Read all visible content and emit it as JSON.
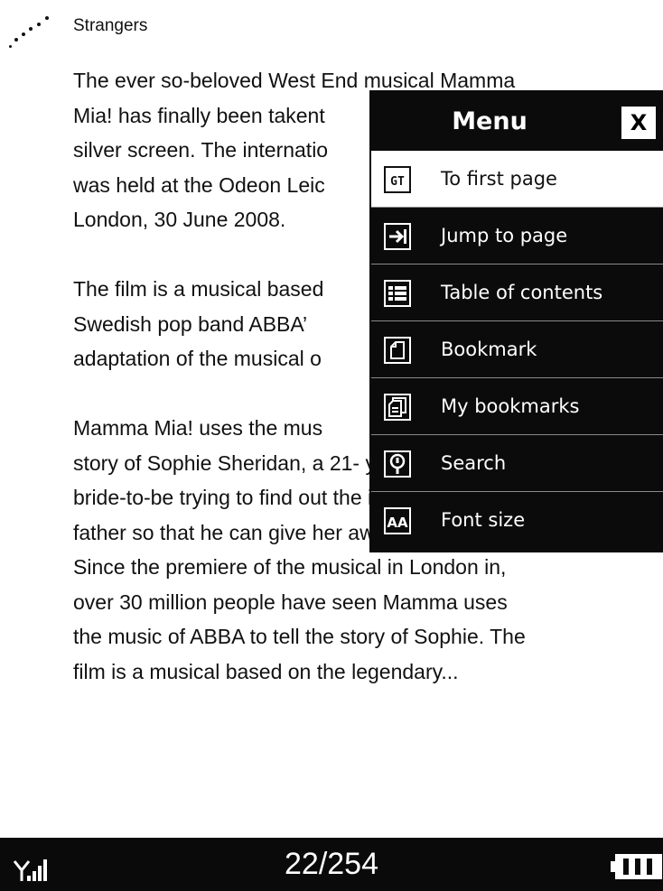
{
  "book": {
    "title": "Strangers",
    "lines": [
      "The ever so-beloved West End musical Mamma",
      "Mia! has finally been takent",
      "silver screen. The internatio",
      "was held at the Odeon Leic",
      "London, 30 June 2008.",
      "",
      "The film is a musical based",
      "Swedish pop band ABBA’",
      "adaptation of the musical o",
      "",
      "Mamma Mia! uses the mus",
      "story of Sophie Sheridan, a 21- year-old",
      "bride-to-be trying to find out the identity of her",
      "father so that he can give her away at the",
      "Since the premiere of the musical in London in,",
      " over 30 million people have seen Mamma uses",
      "the music of ABBA to tell the story of Sophie. The",
      "film is a musical based on the legendary..."
    ]
  },
  "status": {
    "page": "22/254",
    "signal_icon": "signal-icon",
    "battery_icon": "battery-icon"
  },
  "menu": {
    "title": "Menu",
    "close_label": "X",
    "items": [
      {
        "label": "To first page",
        "icon": "first-page-icon",
        "selected": true
      },
      {
        "label": "Jump to page",
        "icon": "jump-to-page-icon",
        "selected": false
      },
      {
        "label": "Table of contents",
        "icon": "table-of-contents-icon",
        "selected": false
      },
      {
        "label": "Bookmark",
        "icon": "bookmark-icon",
        "selected": false
      },
      {
        "label": "My bookmarks",
        "icon": "my-bookmarks-icon",
        "selected": false
      },
      {
        "label": "Search",
        "icon": "search-icon",
        "selected": false
      },
      {
        "label": "Font size",
        "icon": "font-size-icon",
        "selected": false
      }
    ]
  },
  "colors": {
    "background": "#ffffff",
    "bar": "#0a0a0a",
    "menu": "#0b0b0b",
    "selected": "#ffffff"
  }
}
